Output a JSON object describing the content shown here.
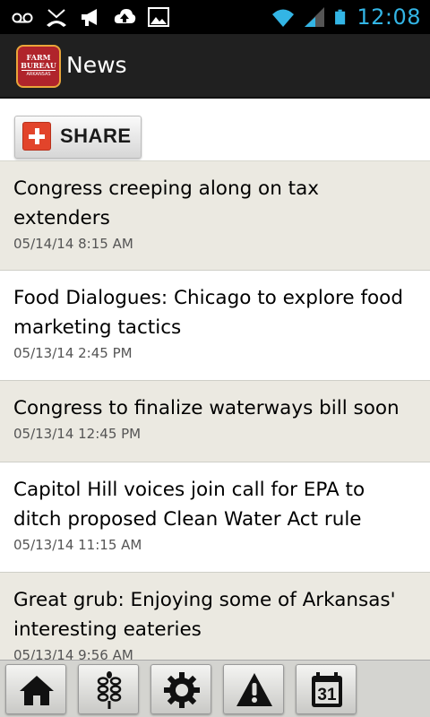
{
  "status_bar": {
    "time": "12:08",
    "left_icons": [
      "voicemail-icon",
      "missed-call-icon",
      "megaphone-icon",
      "upload-icon",
      "image-icon"
    ],
    "right_icons": [
      "wifi-icon",
      "signal-icon",
      "battery-icon"
    ],
    "accent_color": "#33b5e5"
  },
  "action_bar": {
    "logo": {
      "line1": "FARM",
      "line2": "BUREAU",
      "line3": "ARKANSAS"
    },
    "title": "News"
  },
  "share": {
    "label": "SHARE"
  },
  "news": [
    {
      "title": "Congress creeping along on tax extenders",
      "date": "05/14/14 8:15 AM"
    },
    {
      "title": "Food Dialogues: Chicago to explore food marketing tactics",
      "date": "05/13/14 2:45 PM"
    },
    {
      "title": "Congress to finalize waterways bill soon",
      "date": "05/13/14 12:45 PM"
    },
    {
      "title": "Capitol Hill voices join call for EPA to ditch proposed Clean Water Act rule",
      "date": "05/13/14 11:15 AM"
    },
    {
      "title": "Great grub: Enjoying some of Arkansas' interesting eateries",
      "date": "05/13/14 9:56 AM"
    }
  ],
  "toolbar": {
    "buttons": [
      {
        "icon": "home-icon"
      },
      {
        "icon": "wheat-icon"
      },
      {
        "icon": "gear-icon"
      },
      {
        "icon": "warning-icon"
      },
      {
        "icon": "calendar-icon",
        "label": "31"
      }
    ]
  }
}
